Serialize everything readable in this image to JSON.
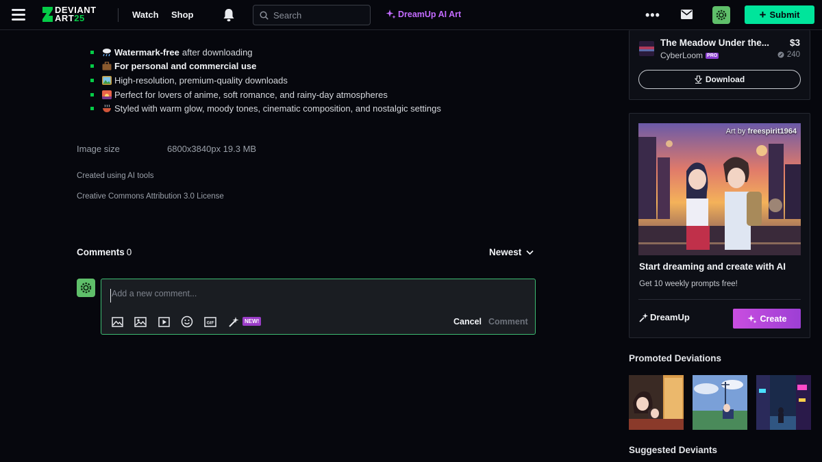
{
  "nav": {
    "logo_line1": "DEVIANT",
    "logo_line2": "ART",
    "logo_25": "25",
    "watch": "Watch",
    "shop": "Shop",
    "search_placeholder": "Search",
    "dreamup": "DreamUp AI Art",
    "more": "•••",
    "submit": "Submit"
  },
  "features": [
    {
      "bold": "Watermark-free",
      "text": "after downloading"
    },
    {
      "bold": "For personal and commercial use",
      "text": ""
    },
    {
      "bold": "",
      "text": "High-resolution, premium-quality downloads"
    },
    {
      "bold": "",
      "text": "Perfect for lovers of anime, soft romance, and rainy-day atmospheres"
    },
    {
      "bold": "",
      "text": "Styled with warm glow, moody tones, cinematic composition, and nostalgic settings"
    }
  ],
  "details": {
    "image_size_label": "Image size",
    "image_size_value": "6800x3840px 19.3 MB",
    "ai_note": "Created using AI tools",
    "license": "Creative Commons Attribution 3.0 License"
  },
  "comments": {
    "title": "Comments",
    "count": "0",
    "sort": "Newest",
    "placeholder": "Add a new comment...",
    "new_badge": "NEW!",
    "cancel": "Cancel",
    "submit": "Comment"
  },
  "purchase": {
    "title": "The Meadow Under the...",
    "price": "$3",
    "author": "CyberLoom",
    "pro": "PRO",
    "points": "240",
    "download": "Download"
  },
  "promo": {
    "credit_prefix": "Art by",
    "credit_user": "freespirit1964",
    "title": "Start dreaming and create with AI",
    "subtitle": "Get 10 weekly prompts free!",
    "brand": "DreamUp",
    "create": "Create"
  },
  "sections": {
    "promoted": "Promoted Deviations",
    "suggested": "Suggested Deviants"
  },
  "colors": {
    "accent_green": "#05cc47",
    "submit_green": "#00e59b",
    "dreamup_purple": "#c36bff",
    "background": "#06070d"
  }
}
